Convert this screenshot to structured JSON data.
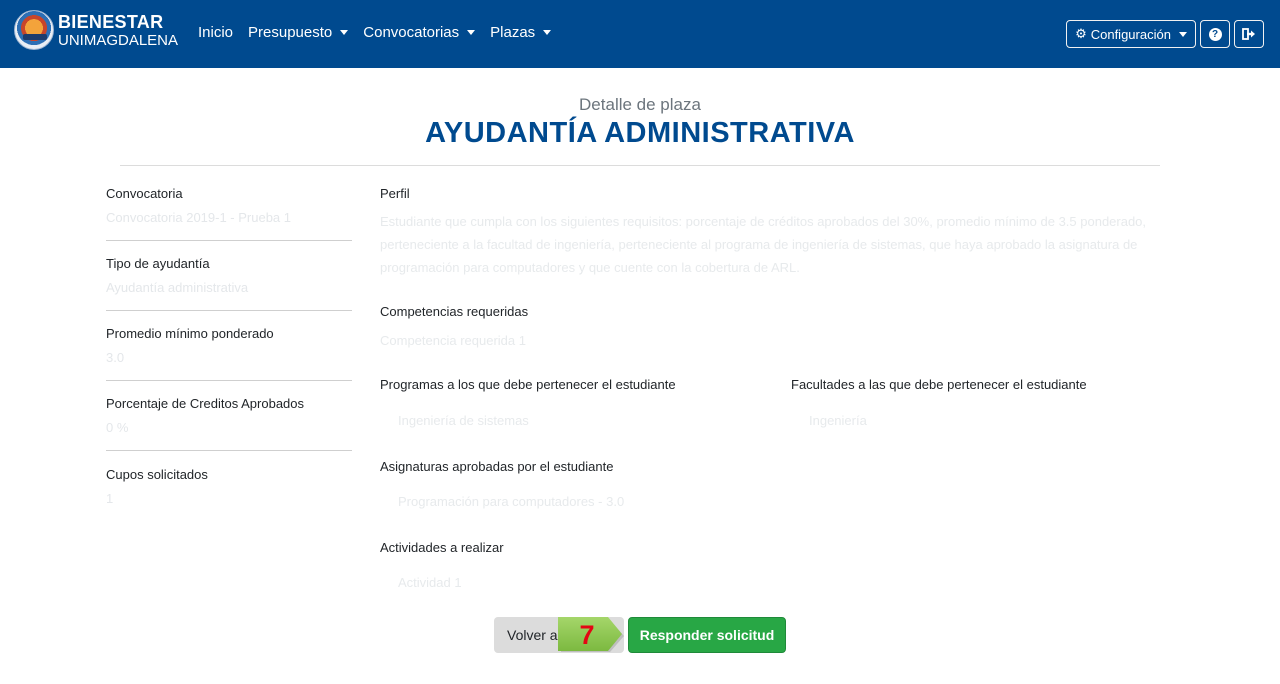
{
  "navbar": {
    "brand_line1": "BIENESTAR",
    "brand_line2": "UNIMAGDALENA",
    "links": [
      {
        "label": "Inicio"
      },
      {
        "label": "Presupuesto"
      },
      {
        "label": "Convocatorias"
      },
      {
        "label": "Plazas"
      }
    ],
    "config_label": "Configuración",
    "help_icon": "question-circle-icon",
    "logout_icon": "sign-out-icon",
    "bg_color": "#004a8f"
  },
  "header": {
    "subtitle": "Detalle de plaza",
    "title": "AYUDANTÍA ADMINISTRATIVA"
  },
  "left": {
    "convocatoria": {
      "label": "Convocatoria",
      "value": "Convocatoria 2019-1 - Prueba 1"
    },
    "tipo": {
      "label": "Tipo de ayudantía",
      "value": "Ayudantía administrativa"
    },
    "promedio": {
      "label": "Promedio mínimo ponderado",
      "value": "3.0"
    },
    "porcentaje": {
      "label": "Porcentaje de Creditos Aprobados",
      "value": "0 %"
    },
    "cupos": {
      "label": "Cupos solicitados",
      "value": "1"
    }
  },
  "right": {
    "perfil": {
      "label": "Perfil",
      "value": "Estudiante que cumpla con los siguientes requisitos: porcentaje de créditos aprobados del 30%, promedio mínimo de 3.5 ponderado, perteneciente a la facultad de ingeniería, perteneciente al programa de ingeniería de sistemas, que haya aprobado la asignatura de programación para computadores y que cuente con la cobertura de ARL."
    },
    "competencias": {
      "label": "Competencias requeridas",
      "value": "Competencia requerida 1"
    },
    "programas": {
      "label": "Programas a los que debe pertenecer el estudiante",
      "value": "Ingeniería de sistemas"
    },
    "facultades": {
      "label": "Facultades a las que debe pertenecer el estudiante",
      "value": "Ingeniería"
    },
    "asignaturas": {
      "label": "Asignaturas aprobadas por el estudiante",
      "value": "Programación para computadores - 3.0"
    },
    "actividades": {
      "label": "Actividades a realizar",
      "value": "Actividad 1"
    }
  },
  "buttons": {
    "volver": "Volver a plazas",
    "responder": "Responder solicitud",
    "responder_color": "#28a745"
  },
  "step_marker": {
    "number": "7",
    "color": "#8dc63f",
    "number_color": "#e30613"
  }
}
